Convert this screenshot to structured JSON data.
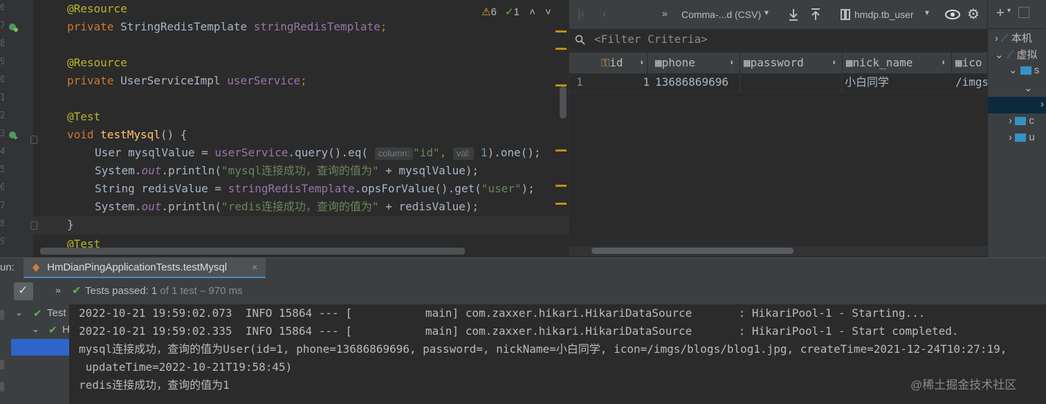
{
  "editor": {
    "line_numbers": [
      "6",
      "7",
      "8",
      "9",
      "0",
      "1",
      "2",
      "3",
      "4",
      "5",
      "6",
      "7",
      "8",
      "9"
    ],
    "lines": {
      "l1": "@Resource",
      "l2_kw": "private",
      "l2_type": " StringRedisTemplate ",
      "l2_field": "stringRedisTemplate",
      "l2_end": ";",
      "l4": "@Resource",
      "l5_kw": "private",
      "l5_type": " UserServiceImpl ",
      "l5_field": "userService",
      "l5_end": ";",
      "l7": "@Test",
      "l8_kw": "void",
      "l8_fn": "testMysql",
      "l8_rest": "() {",
      "l9_a": "User mysqlValue = ",
      "l9_field": "userService",
      "l9_b": ".query().eq(",
      "l9_hint1": "column:",
      "l9_str": "\"id\"",
      "l9_c": ", ",
      "l9_hint2": "val:",
      "l9_num": "1",
      "l9_d": ").one();",
      "l10_a": "System.",
      "l10_out": "out",
      "l10_b": ".println(",
      "l10_str": "\"mysql连接成功，查询的值为\"",
      "l10_c": " + mysqlValue);",
      "l11_a": "String redisValue = ",
      "l11_field": "stringRedisTemplate",
      "l11_b": ".opsForValue().get(",
      "l11_str": "\"user\"",
      "l11_c": ");",
      "l12_a": "System.",
      "l12_out": "out",
      "l12_b": ".println(",
      "l12_str": "\"redis连接成功，查询的值为\"",
      "l12_c": " + redisValue);",
      "l13": "}",
      "l14": "@Test"
    },
    "inspections": {
      "warnings": "6",
      "typos": "1"
    }
  },
  "db": {
    "toolbar": {
      "format": "Comma-...d (CSV)",
      "table": "hmdp.tb_user"
    },
    "filter_placeholder": "<Filter Criteria>",
    "columns": [
      "id",
      "phone",
      "password",
      "nick_name",
      "ico"
    ],
    "rows": [
      {
        "rownum": "1",
        "id": "1",
        "phone": "13686869696",
        "password": "",
        "nick_name": "小白同学",
        "icon": "/imgs"
      }
    ]
  },
  "tree": {
    "item1": "本机",
    "item2": "虚拟",
    "item3": "s",
    "item4": "c",
    "item5": "u"
  },
  "run": {
    "label": "un:",
    "tab": "HmDianPingApplicationTests.testMysql",
    "status_prefix": "Tests passed:",
    "status_count": "1",
    "status_suffix": "of 1 test – 970 ms",
    "tree_item1": "Test",
    "tree_item2": "H",
    "console": [
      "2022-10-21 19:59:02.073  INFO 15864 --- [           main] com.zaxxer.hikari.HikariDataSource       : HikariPool-1 - Starting...",
      "2022-10-21 19:59:02.335  INFO 15864 --- [           main] com.zaxxer.hikari.HikariDataSource       : HikariPool-1 - Start completed.",
      "mysql连接成功，查询的值为User(id=1, phone=13686869696, password=, nickName=小白同学, icon=/imgs/blogs/blog1.jpg, createTime=2021-12-24T10:27:19,",
      " updateTime=2022-10-21T19:58:45)",
      "redis连接成功，查询的值为1"
    ]
  },
  "watermark": "@稀土掘金技术社区",
  "colors": {
    "accent": "#365880",
    "warning": "#be9117",
    "passed": "#5fb049"
  }
}
